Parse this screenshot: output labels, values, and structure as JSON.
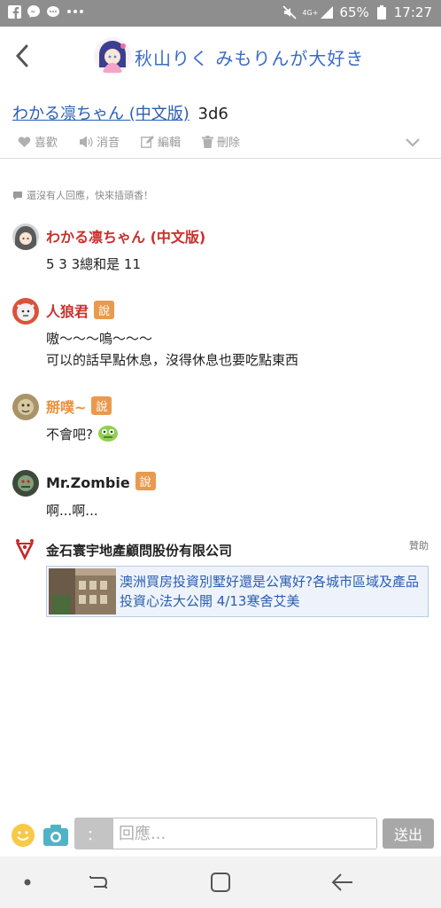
{
  "status_bar": {
    "left_icons": [
      "facebook-icon",
      "messenger-icon",
      "chat-icon",
      "more-dots-icon"
    ],
    "network": "4G+",
    "battery": "65%",
    "time": "17:27"
  },
  "header": {
    "title": "秋山りく みもりんが大好き",
    "back_icon": "chevron-left-icon"
  },
  "post": {
    "author_link": "わかる凛ちゃん (中文版)",
    "dice_text": "3d6"
  },
  "actions": {
    "like": "喜歡",
    "mute": "消音",
    "edit": "編輯",
    "delete": "刪除"
  },
  "hint": "還沒有人回應，快來插頭香！",
  "comments": [
    {
      "name": "わかる凛ちゃん (中文版)",
      "name_color": "#c9302c",
      "badge": "",
      "lines": [
        "5 3 3總和是 11"
      ]
    },
    {
      "name": "人狼君",
      "name_color": "#c9302c",
      "badge": "說",
      "lines": [
        "嗷～～～嗚～～～",
        "可以的話早點休息，沒得休息也要吃點東西"
      ]
    },
    {
      "name": "掰噗~",
      "name_color": "#e8903c",
      "badge": "說",
      "lines": [
        "不會吧? "
      ]
    },
    {
      "name": "Mr.Zombie",
      "name_color": "#222222",
      "badge": "說",
      "lines": [
        "啊...啊..."
      ]
    }
  ],
  "ad": {
    "advertiser": "金石寰宇地產顧問股份有限公司",
    "label": "贊助",
    "text": "澳洲買房投資別墅好還是公寓好?各城市區域及產品投資心法大公開 4/13寒舍艾美"
  },
  "input_bar": {
    "colon": "：",
    "placeholder": "回應...",
    "send": "送出"
  },
  "colors": {
    "link": "#2a5db0",
    "badge": "#e99a4e",
    "status_bar": "#8e8e8e"
  }
}
